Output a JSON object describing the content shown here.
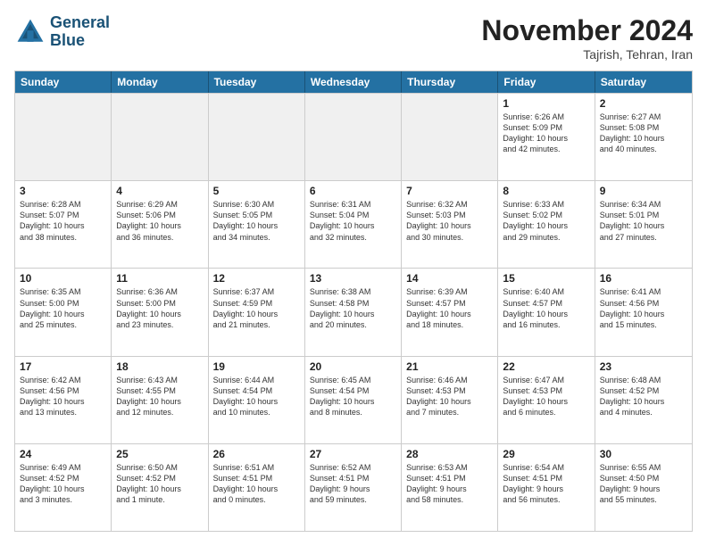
{
  "logo": {
    "line1": "General",
    "line2": "Blue"
  },
  "title": "November 2024",
  "subtitle": "Tajrish, Tehran, Iran",
  "days": [
    "Sunday",
    "Monday",
    "Tuesday",
    "Wednesday",
    "Thursday",
    "Friday",
    "Saturday"
  ],
  "rows": [
    [
      {
        "day": "",
        "info": ""
      },
      {
        "day": "",
        "info": ""
      },
      {
        "day": "",
        "info": ""
      },
      {
        "day": "",
        "info": ""
      },
      {
        "day": "",
        "info": ""
      },
      {
        "day": "1",
        "info": "Sunrise: 6:26 AM\nSunset: 5:09 PM\nDaylight: 10 hours\nand 42 minutes."
      },
      {
        "day": "2",
        "info": "Sunrise: 6:27 AM\nSunset: 5:08 PM\nDaylight: 10 hours\nand 40 minutes."
      }
    ],
    [
      {
        "day": "3",
        "info": "Sunrise: 6:28 AM\nSunset: 5:07 PM\nDaylight: 10 hours\nand 38 minutes."
      },
      {
        "day": "4",
        "info": "Sunrise: 6:29 AM\nSunset: 5:06 PM\nDaylight: 10 hours\nand 36 minutes."
      },
      {
        "day": "5",
        "info": "Sunrise: 6:30 AM\nSunset: 5:05 PM\nDaylight: 10 hours\nand 34 minutes."
      },
      {
        "day": "6",
        "info": "Sunrise: 6:31 AM\nSunset: 5:04 PM\nDaylight: 10 hours\nand 32 minutes."
      },
      {
        "day": "7",
        "info": "Sunrise: 6:32 AM\nSunset: 5:03 PM\nDaylight: 10 hours\nand 30 minutes."
      },
      {
        "day": "8",
        "info": "Sunrise: 6:33 AM\nSunset: 5:02 PM\nDaylight: 10 hours\nand 29 minutes."
      },
      {
        "day": "9",
        "info": "Sunrise: 6:34 AM\nSunset: 5:01 PM\nDaylight: 10 hours\nand 27 minutes."
      }
    ],
    [
      {
        "day": "10",
        "info": "Sunrise: 6:35 AM\nSunset: 5:00 PM\nDaylight: 10 hours\nand 25 minutes."
      },
      {
        "day": "11",
        "info": "Sunrise: 6:36 AM\nSunset: 5:00 PM\nDaylight: 10 hours\nand 23 minutes."
      },
      {
        "day": "12",
        "info": "Sunrise: 6:37 AM\nSunset: 4:59 PM\nDaylight: 10 hours\nand 21 minutes."
      },
      {
        "day": "13",
        "info": "Sunrise: 6:38 AM\nSunset: 4:58 PM\nDaylight: 10 hours\nand 20 minutes."
      },
      {
        "day": "14",
        "info": "Sunrise: 6:39 AM\nSunset: 4:57 PM\nDaylight: 10 hours\nand 18 minutes."
      },
      {
        "day": "15",
        "info": "Sunrise: 6:40 AM\nSunset: 4:57 PM\nDaylight: 10 hours\nand 16 minutes."
      },
      {
        "day": "16",
        "info": "Sunrise: 6:41 AM\nSunset: 4:56 PM\nDaylight: 10 hours\nand 15 minutes."
      }
    ],
    [
      {
        "day": "17",
        "info": "Sunrise: 6:42 AM\nSunset: 4:56 PM\nDaylight: 10 hours\nand 13 minutes."
      },
      {
        "day": "18",
        "info": "Sunrise: 6:43 AM\nSunset: 4:55 PM\nDaylight: 10 hours\nand 12 minutes."
      },
      {
        "day": "19",
        "info": "Sunrise: 6:44 AM\nSunset: 4:54 PM\nDaylight: 10 hours\nand 10 minutes."
      },
      {
        "day": "20",
        "info": "Sunrise: 6:45 AM\nSunset: 4:54 PM\nDaylight: 10 hours\nand 8 minutes."
      },
      {
        "day": "21",
        "info": "Sunrise: 6:46 AM\nSunset: 4:53 PM\nDaylight: 10 hours\nand 7 minutes."
      },
      {
        "day": "22",
        "info": "Sunrise: 6:47 AM\nSunset: 4:53 PM\nDaylight: 10 hours\nand 6 minutes."
      },
      {
        "day": "23",
        "info": "Sunrise: 6:48 AM\nSunset: 4:52 PM\nDaylight: 10 hours\nand 4 minutes."
      }
    ],
    [
      {
        "day": "24",
        "info": "Sunrise: 6:49 AM\nSunset: 4:52 PM\nDaylight: 10 hours\nand 3 minutes."
      },
      {
        "day": "25",
        "info": "Sunrise: 6:50 AM\nSunset: 4:52 PM\nDaylight: 10 hours\nand 1 minute."
      },
      {
        "day": "26",
        "info": "Sunrise: 6:51 AM\nSunset: 4:51 PM\nDaylight: 10 hours\nand 0 minutes."
      },
      {
        "day": "27",
        "info": "Sunrise: 6:52 AM\nSunset: 4:51 PM\nDaylight: 9 hours\nand 59 minutes."
      },
      {
        "day": "28",
        "info": "Sunrise: 6:53 AM\nSunset: 4:51 PM\nDaylight: 9 hours\nand 58 minutes."
      },
      {
        "day": "29",
        "info": "Sunrise: 6:54 AM\nSunset: 4:51 PM\nDaylight: 9 hours\nand 56 minutes."
      },
      {
        "day": "30",
        "info": "Sunrise: 6:55 AM\nSunset: 4:50 PM\nDaylight: 9 hours\nand 55 minutes."
      }
    ]
  ]
}
